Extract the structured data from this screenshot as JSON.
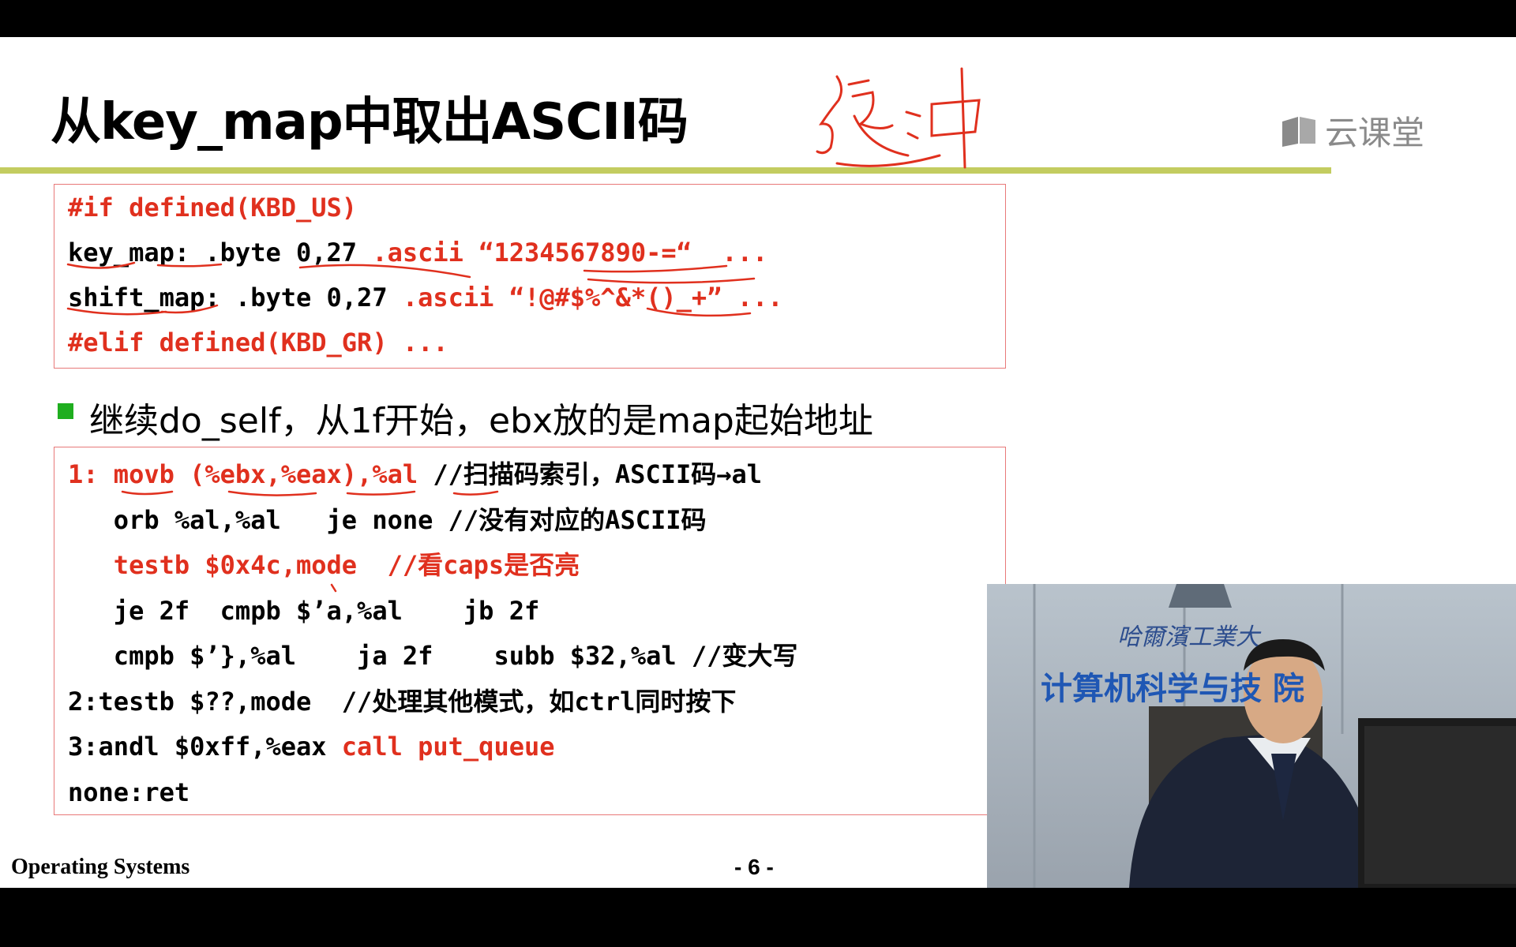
{
  "slide": {
    "title": "从key_map中取出ASCII码",
    "handwriting_title": "缓冲",
    "logo_text": "云课堂",
    "code_block_1": [
      [
        {
          "t": "#if defined(KBD_US)",
          "c": "red"
        }
      ],
      [
        {
          "t": "key_map: .byte 0,27 ",
          "c": "blk"
        },
        {
          "t": ".ascii “1234567890-=“  ...",
          "c": "red"
        }
      ],
      [
        {
          "t": "shift_map: .byte 0,27 ",
          "c": "blk"
        },
        {
          "t": ".ascii “!@#$%^&*()_+” ...",
          "c": "red"
        }
      ],
      [
        {
          "t": "#elif defined(KBD_GR) ...",
          "c": "red"
        }
      ]
    ],
    "bullet": "继续do_self，从1f开始，ebx放的是map起始地址",
    "code_block_2": [
      [
        {
          "t": "1: ",
          "c": "red"
        },
        {
          "t": "movb (%ebx,%eax),%al ",
          "c": "red"
        },
        {
          "t": "//扫描码索引，ASCII码→al",
          "c": "blk"
        }
      ],
      [
        {
          "t": "   orb %al,%al   je none //没有对应的ASCII码",
          "c": "blk"
        }
      ],
      [
        {
          "t": "   testb $0x4c,mode  //看caps是否亮",
          "c": "red"
        }
      ],
      [
        {
          "t": "   je 2f  cmpb $’a,%al    jb 2f",
          "c": "blk"
        }
      ],
      [
        {
          "t": "   cmpb $’},%al    ja 2f    subb $32,%al //变大写",
          "c": "blk"
        }
      ],
      [
        {
          "t": "2:testb $??,mode  //处理其他模式，如ctrl同时按下",
          "c": "blk"
        }
      ],
      [
        {
          "t": "3:andl $0xff,%eax ",
          "c": "blk"
        },
        {
          "t": "call put_queue",
          "c": "red"
        }
      ],
      [
        {
          "t": "none:ret",
          "c": "blk"
        }
      ]
    ],
    "footer_left": "Operating Systems",
    "footer_page": "- 6 -"
  },
  "video": {
    "caption_line1": "哈爾濱工業大",
    "caption_line2": "计算机科学与技  院"
  },
  "colors": {
    "red": "#e0301e",
    "rule": "#c3cc60",
    "bullet": "#1fae1f",
    "box_border": "#e87979"
  }
}
